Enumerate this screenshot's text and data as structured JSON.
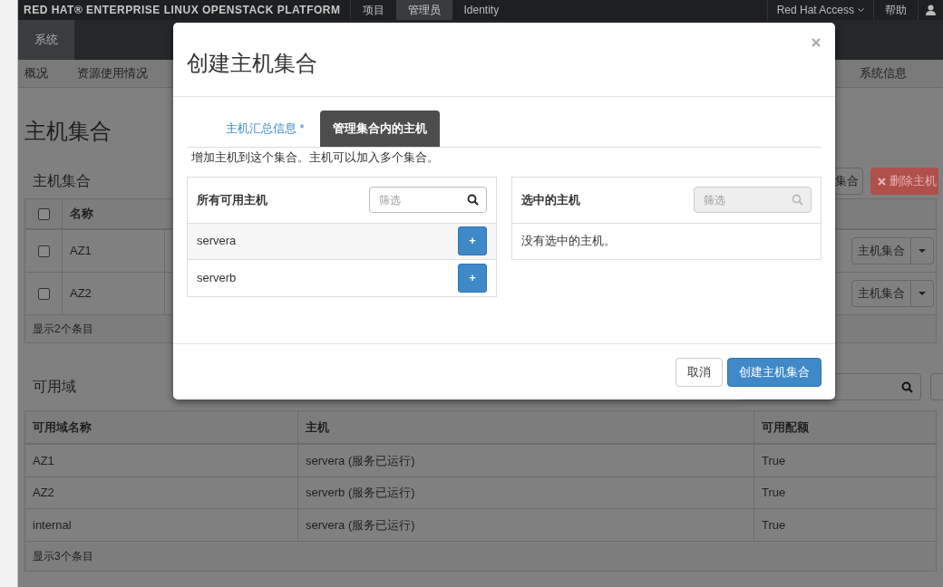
{
  "brand": "RED HAT® ENTERPRISE LINUX OPENSTACK PLATFORM",
  "top_nav": [
    {
      "label": "项目",
      "selected": false
    },
    {
      "label": "管理员",
      "selected": true
    },
    {
      "label": "Identity",
      "selected": false
    }
  ],
  "top_right": {
    "access_menu": "Red Hat Access",
    "help": "帮助"
  },
  "panel_tabs": [
    {
      "label": "系统",
      "selected": true
    }
  ],
  "sub_nav": {
    "left": [
      "概况",
      "资源使用情况"
    ],
    "right": [
      "系统信息"
    ]
  },
  "page_title": "主机集合",
  "aggregates": {
    "title": "主机集合",
    "buttons": [
      {
        "kind": "default",
        "label": "集合"
      },
      {
        "kind": "danger",
        "label": "删除主机"
      }
    ],
    "select_all": {
      "checked": false
    },
    "columns": [
      "名称"
    ],
    "rows": [
      {
        "name": "AZ1",
        "checked": false,
        "action": "主机集合"
      },
      {
        "name": "AZ2",
        "checked": false,
        "action": "主机集合"
      }
    ],
    "footer": "显示2个条目"
  },
  "zones": {
    "title": "可用域",
    "columns": [
      "可用域名称",
      "主机",
      "可用配额"
    ],
    "rows": [
      [
        "AZ1",
        "servera (服务已运行)",
        "True"
      ],
      [
        "AZ2",
        "serverb (服务已运行)",
        "True"
      ],
      [
        "internal",
        "servera (服务已运行)",
        "True"
      ]
    ],
    "footer": "显示3个条目"
  },
  "modal": {
    "title": "创建主机集合",
    "tabs": [
      {
        "label": "主机汇总信息 *",
        "selected": false
      },
      {
        "label": "管理集合内的主机",
        "selected": true
      }
    ],
    "help": "增加主机到这个集合。主机可以加入多个集合。",
    "available": {
      "title": "所有可用主机",
      "filter": {
        "placeholder": "筛选",
        "disabled": false
      },
      "hosts": [
        {
          "name": "servera"
        },
        {
          "name": "serverb"
        }
      ],
      "add_label": "+"
    },
    "selected": {
      "title": "选中的主机",
      "filter": {
        "placeholder": "筛选",
        "disabled": true
      },
      "empty": "没有选中的主机。"
    },
    "buttons": [
      {
        "kind": "default",
        "label": "取消"
      },
      {
        "kind": "primary",
        "label": "创建主机集合"
      }
    ]
  }
}
